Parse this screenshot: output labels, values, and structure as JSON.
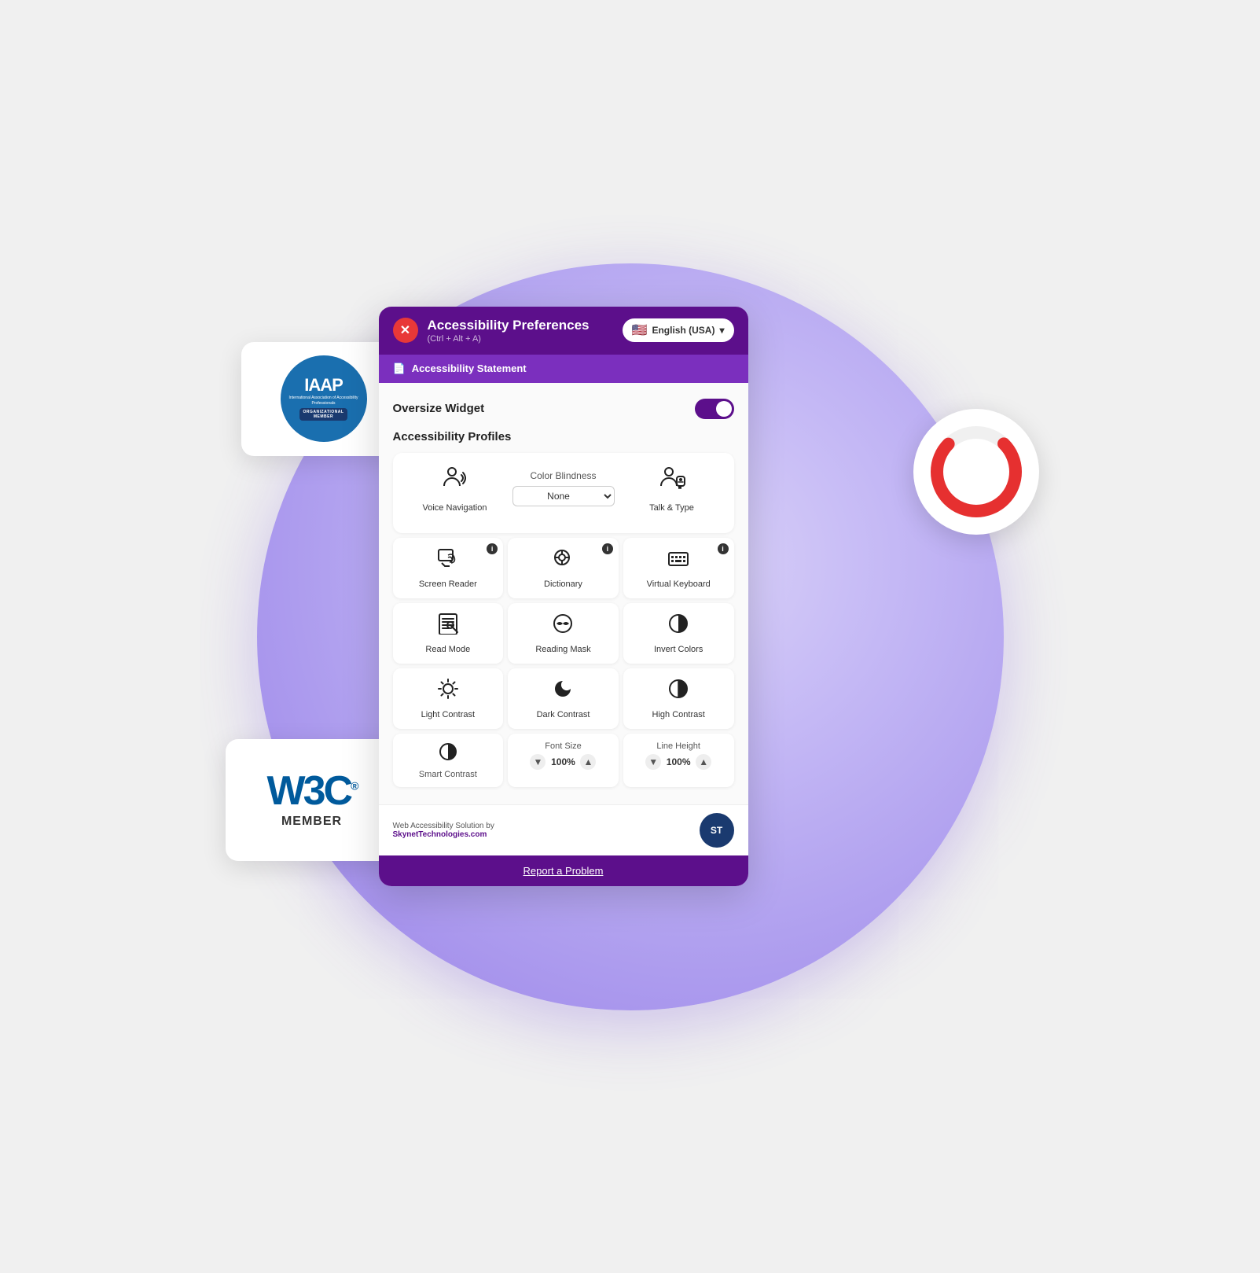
{
  "header": {
    "title": "Accessibility Preferences",
    "shortcut": "(Ctrl + Alt + A)",
    "close_label": "✕",
    "lang_label": "English (USA)",
    "flag": "🇺🇸"
  },
  "statement_bar": {
    "icon": "📄",
    "label": "Accessibility Statement"
  },
  "oversize": {
    "label": "Oversize Widget"
  },
  "profiles": {
    "label": "Accessibility Profiles"
  },
  "top_row": {
    "voice_nav_label": "Voice Navigation",
    "color_blindness_label": "Color Blindness",
    "color_blindness_value": "None",
    "talk_type_label": "Talk & Type"
  },
  "features": [
    {
      "id": "screen-reader",
      "icon": "📖",
      "label": "Screen Reader",
      "info": true
    },
    {
      "id": "dictionary",
      "icon": "🔍",
      "label": "Dictionary",
      "info": true
    },
    {
      "id": "virtual-keyboard",
      "icon": "⌨️",
      "label": "Virtual Keyboard",
      "info": true
    },
    {
      "id": "read-mode",
      "icon": "📰",
      "label": "Read Mode",
      "info": false
    },
    {
      "id": "reading-mask",
      "icon": "◉",
      "label": "Reading Mask",
      "info": false
    },
    {
      "id": "invert-colors",
      "icon": "◑",
      "label": "Invert Colors",
      "info": false
    },
    {
      "id": "light-contrast",
      "icon": "☀️",
      "label": "Light Contrast",
      "info": false
    },
    {
      "id": "dark-contrast",
      "icon": "🌙",
      "label": "Dark Contrast",
      "info": false
    },
    {
      "id": "high-contrast",
      "icon": "◐",
      "label": "High Contrast",
      "info": false
    }
  ],
  "bottom": {
    "smart_contrast_label": "Smart Contrast",
    "font_size_label": "Font Size",
    "font_size_value": "100%",
    "line_height_label": "Line Height",
    "line_height_value": "100%"
  },
  "footer": {
    "text1": "Web Accessibility Solution by",
    "text2": "SkynetTechnologies.com",
    "logo_text": "ST"
  },
  "report": {
    "label": "Report a Problem"
  },
  "iaap": {
    "main": "IAAP",
    "sub": "International Association\nof Accessibility Professionals",
    "org": "ORGANIZATIONAL\nMEMBER"
  },
  "w3c": {
    "logo": "W3C",
    "reg": "®",
    "member": "MEMBER"
  }
}
